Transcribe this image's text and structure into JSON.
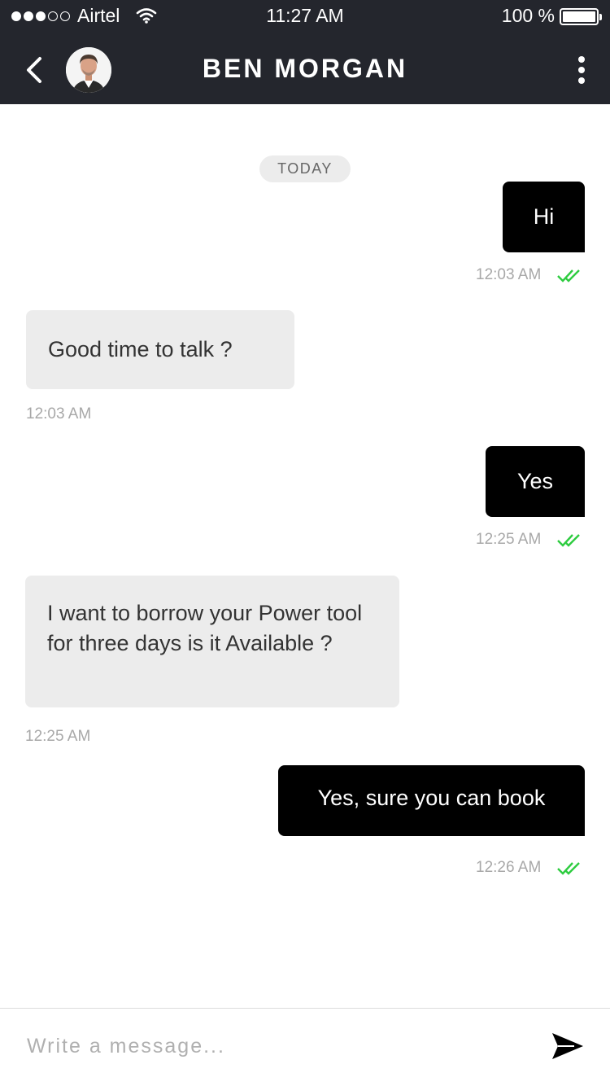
{
  "status_bar": {
    "carrier": "Airtel",
    "time": "11:27 AM",
    "battery": "100 %"
  },
  "header": {
    "title": "BEN MORGAN"
  },
  "chat": {
    "date_divider": "TODAY",
    "messages": [
      {
        "direction": "outgoing",
        "text": "Hi",
        "time": "12:03 AM",
        "read": true
      },
      {
        "direction": "incoming",
        "text": "Good time to talk ?",
        "time": "12:03 AM"
      },
      {
        "direction": "outgoing",
        "text": "Yes",
        "time": "12:25 AM",
        "read": true
      },
      {
        "direction": "incoming",
        "text": "I want to borrow your Power tool for three days is it Available ?",
        "time": "12:25 AM"
      },
      {
        "direction": "outgoing",
        "text": "Yes, sure you can book",
        "time": "12:26 AM",
        "read": true
      }
    ]
  },
  "composer": {
    "placeholder": "Write a message..."
  },
  "colors": {
    "header_bg": "#24262d",
    "outgoing_bubble": "#000000",
    "incoming_bubble": "#ececec",
    "read_tick": "#2ecc40"
  }
}
